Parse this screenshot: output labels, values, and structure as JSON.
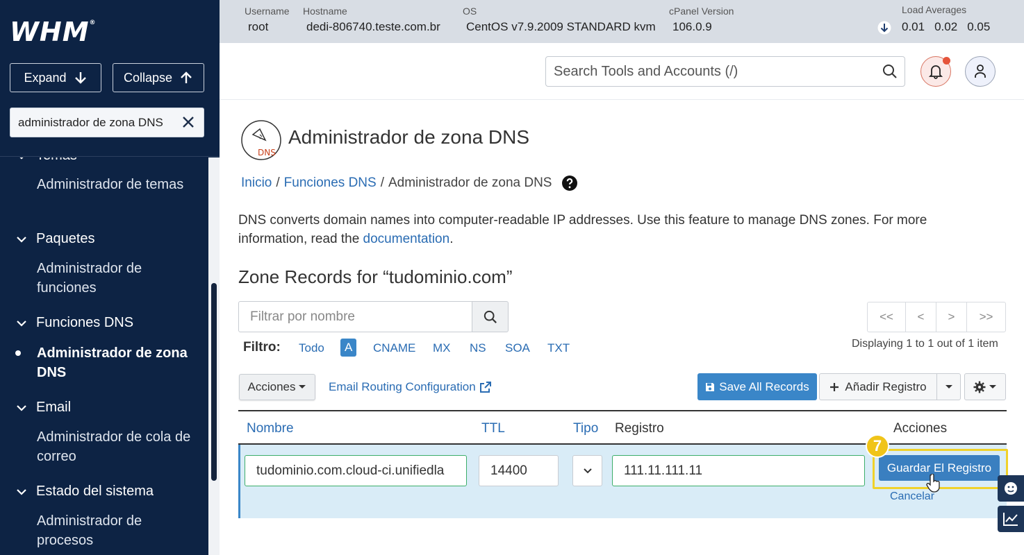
{
  "brand": {
    "logo": "WHM",
    "reg": "®"
  },
  "sidebar": {
    "expand_label": "Expand",
    "collapse_label": "Collapse",
    "search_value": "administrador de zona DNS",
    "partial_category": "Temas",
    "categories": [
      {
        "label": "Paquetes"
      },
      {
        "label": "Funciones DNS"
      },
      {
        "label": "Email"
      },
      {
        "label": "Estado del sistema"
      }
    ],
    "items": [
      {
        "label": "Administrador de temas"
      },
      {
        "label": "Administrador de funciones"
      },
      {
        "label": "Administrador de zona DNS"
      },
      {
        "label": "Administrador de cola de correo"
      },
      {
        "label": "Administrador de procesos"
      }
    ]
  },
  "infobar": {
    "username_label": "Username",
    "username": "root",
    "hostname_label": "Hostname",
    "hostname": "dedi-806740.teste.com.br",
    "os_label": "OS",
    "os": "CentOS v7.9.2009 STANDARD kvm",
    "cpanel_label": "cPanel Version",
    "cpanel": "106.0.9",
    "load_label": "Load Averages",
    "load1": "0.01",
    "load2": "0.02",
    "load3": "0.05"
  },
  "header": {
    "search_placeholder": "Search Tools and Accounts (/)"
  },
  "page": {
    "icon_text": "DNS",
    "title": "Administrador de zona DNS",
    "crumb_home": "Inicio",
    "crumb_sep": "/",
    "crumb_dns": "Funciones DNS",
    "crumb_current": "Administrador de zona DNS",
    "desc_text": "DNS converts domain names into computer-readable IP addresses. Use this feature to manage DNS zones. For more information, read the ",
    "desc_link": "documentation",
    "desc_end": ".",
    "zone_title": "Zone Records for “tudominio.com”"
  },
  "filter": {
    "placeholder": "Filtrar por nombre",
    "label": "Filtro:",
    "types": [
      "Todo",
      "A",
      "CNAME",
      "MX",
      "NS",
      "SOA",
      "TXT"
    ],
    "active": "A"
  },
  "pager": {
    "first": "<<",
    "prev": "<",
    "next": ">",
    "last": ">>",
    "displaying": "Displaying 1 to 1 out of 1 item"
  },
  "toolbar": {
    "acciones": "Acciones",
    "email_routing": "Email Routing Configuration",
    "save_all": "Save All Records",
    "add_record": "Añadir Registro"
  },
  "table": {
    "headers": {
      "name": "Nombre",
      "ttl": "TTL",
      "type": "Tipo",
      "record": "Registro",
      "actions": "Acciones"
    }
  },
  "edit_row": {
    "name": "tudominio.com.cloud-ci.unifiedla",
    "ttl": "14400",
    "record": "111.11.111.11",
    "save": "Guardar El Registro",
    "cancel": "Cancelar",
    "step": "7"
  },
  "colors": {
    "sidebar": "#0d2344",
    "accent": "#3a86c8",
    "highlight": "#f0d22a",
    "notify": "#e5543b"
  }
}
